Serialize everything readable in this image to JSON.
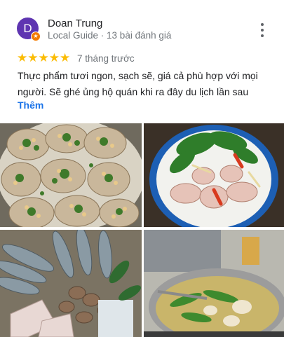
{
  "reviewer": {
    "initial": "D",
    "name": "Doan Trung",
    "meta": "Local Guide · 13 bài đánh giá"
  },
  "rating": {
    "stars": 5,
    "stars_text": "★★★★★",
    "time": "7 tháng trước"
  },
  "review": {
    "text": "Thực phẩm tươi ngon, sạch sẽ, giá cả phù hợp với mọi người. Sẽ ghé ủng hộ quán khi ra đây du lịch lần sau",
    "more_label": "Thêm"
  },
  "icons": {
    "more": "more-vert-icon",
    "local_guide": "local-guide-badge-icon"
  },
  "colors": {
    "avatar": "#5e35b1",
    "star": "#fbbc04",
    "link": "#1a73e8"
  }
}
